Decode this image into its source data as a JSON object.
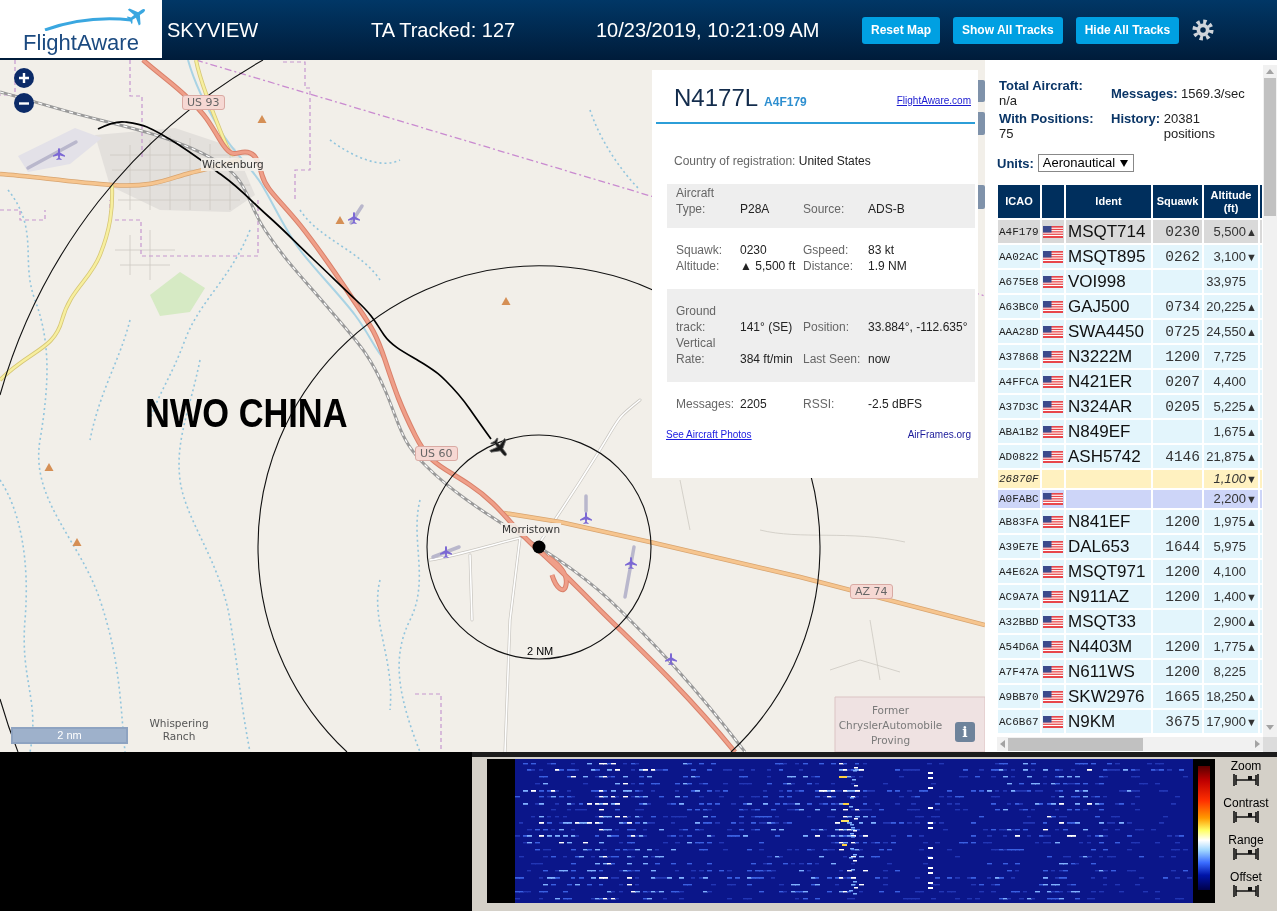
{
  "header": {
    "logo": "FlightAware",
    "title": "SKYVIEW",
    "tracked": "TA Tracked: 127",
    "datetime": "10/23/2019, 10:21:09 AM",
    "buttons": [
      "Reset Map",
      "Show All Tracks",
      "Hide All Tracks"
    ]
  },
  "map": {
    "labels": [
      {
        "kind": "shield",
        "text": "US 93"
      },
      {
        "kind": "town",
        "text": "Wickenburg"
      },
      {
        "kind": "shield",
        "text": "US 60"
      },
      {
        "kind": "town",
        "text": "Morristown"
      },
      {
        "kind": "shield",
        "text": "AZ 74"
      },
      {
        "kind": "ring",
        "text": "2 NM"
      },
      {
        "kind": "place",
        "text": "Whispering Ranch"
      },
      {
        "kind": "area",
        "text": "Former ChryslerAutomobile Proving"
      }
    ],
    "caption": "NWO CHINA",
    "scale": "2 nm",
    "info_button": "i"
  },
  "selected_aircraft": {
    "registration": "N4177L",
    "icao": "A4F179",
    "link": "FlightAware.com",
    "country_label": "Country of registration:",
    "country": "United States",
    "sections": [
      {
        "shaded": true,
        "rows": [
          [
            {
              "label": "Aircraft Type:",
              "value": "P28A"
            },
            {
              "label": "Source:",
              "value": "ADS-B"
            }
          ]
        ]
      },
      {
        "shaded": false,
        "rows": [
          [
            {
              "label": "Squawk:",
              "value": "0230"
            },
            {
              "label": "Gspeed:",
              "value": "83 kt"
            }
          ],
          [
            {
              "label": "Altitude:",
              "value": "▲ 5,500 ft"
            },
            {
              "label": "Distance:",
              "value": "1.9 NM"
            }
          ]
        ]
      },
      {
        "shaded": true,
        "rows": [
          [
            {
              "label": "Ground track:",
              "value": "141° (SE)"
            },
            {
              "label": "Position:",
              "value": "33.884°, -112.635°"
            }
          ],
          [
            {
              "label": "Vertical Rate:",
              "value": "384 ft/min"
            },
            {
              "label": "Last Seen:",
              "value": "now"
            }
          ]
        ]
      },
      {
        "shaded": false,
        "rows": [
          [
            {
              "label": "Messages:",
              "value": "2205"
            },
            {
              "label": "RSSI:",
              "value": "-2.5 dBFS"
            }
          ]
        ]
      }
    ],
    "links": [
      "See Aircraft Photos",
      "AirFrames.org"
    ]
  },
  "stats": [
    {
      "label": "Total Aircraft:",
      "value": "n/a"
    },
    {
      "label": "Messages:",
      "value": "1569.3/sec"
    },
    {
      "label": "With Positions:",
      "value": "75"
    },
    {
      "label": "History:",
      "value": "20381 positions"
    }
  ],
  "units": {
    "label": "Units:",
    "value": "Aeronautical"
  },
  "table": {
    "columns": [
      "ICAO",
      "Ident",
      "Squawk",
      "Altitude (ft)"
    ],
    "rows": [
      {
        "icao": "A4F179",
        "flag": true,
        "ident": "MSQT714",
        "squawk": "0230",
        "altitude": "5,500",
        "trend": "▲",
        "kind": "default",
        "selected": true
      },
      {
        "icao": "AA02AC",
        "flag": true,
        "ident": "MSQT895",
        "squawk": "0262",
        "altitude": "3,100",
        "trend": "▼",
        "kind": "default",
        "selected": false
      },
      {
        "icao": "A675E8",
        "flag": true,
        "ident": "VOI998",
        "altitude": "33,975",
        "kind": "default",
        "selected": false
      },
      {
        "icao": "A63BC0",
        "flag": true,
        "ident": "GAJ500",
        "squawk": "0734",
        "altitude": "20,225",
        "trend": "▲",
        "kind": "default",
        "selected": false
      },
      {
        "icao": "AAA28D",
        "flag": true,
        "ident": "SWA4450",
        "squawk": "0725",
        "altitude": "24,550",
        "trend": "▲",
        "kind": "default",
        "selected": false
      },
      {
        "icao": "A37868",
        "flag": true,
        "ident": "N3222M",
        "squawk": "1200",
        "altitude": "7,725",
        "kind": "default",
        "selected": false
      },
      {
        "icao": "A4FFCA",
        "flag": true,
        "ident": "N421ER",
        "squawk": "0207",
        "altitude": "4,400",
        "kind": "default",
        "selected": false
      },
      {
        "icao": "A37D3C",
        "flag": true,
        "ident": "N324AR",
        "squawk": "0205",
        "altitude": "5,225",
        "trend": "▲",
        "kind": "default",
        "selected": false
      },
      {
        "icao": "ABA1B2",
        "flag": true,
        "ident": "N849EF",
        "altitude": "1,675",
        "trend": "▲",
        "kind": "default",
        "selected": false
      },
      {
        "icao": "AD0822",
        "flag": true,
        "ident": "ASH5742",
        "squawk": "4146",
        "altitude": "21,875",
        "trend": "▲",
        "kind": "default",
        "selected": false
      },
      {
        "icao": "26870F",
        "flag": false,
        "altitude": "1,100",
        "trend": "▼",
        "kind": "yellow",
        "selected": false
      },
      {
        "icao": "A0FABC",
        "flag": true,
        "altitude": "2,200",
        "trend": "▼",
        "kind": "lavender",
        "selected": false
      },
      {
        "icao": "AB83FA",
        "flag": true,
        "ident": "N841EF",
        "squawk": "1200",
        "altitude": "1,975",
        "trend": "▲",
        "kind": "default",
        "selected": false
      },
      {
        "icao": "A39E7E",
        "flag": true,
        "ident": "DAL653",
        "squawk": "1644",
        "altitude": "5,975",
        "kind": "default",
        "selected": false
      },
      {
        "icao": "A4E62A",
        "flag": true,
        "ident": "MSQT971",
        "squawk": "1200",
        "altitude": "4,100",
        "kind": "default",
        "selected": false
      },
      {
        "icao": "AC9A7A",
        "flag": true,
        "ident": "N911AZ",
        "squawk": "1200",
        "altitude": "1,400",
        "trend": "▼",
        "kind": "default",
        "selected": false
      },
      {
        "icao": "A32BBD",
        "flag": true,
        "ident": "MSQT33",
        "altitude": "2,900",
        "trend": "▲",
        "kind": "default",
        "selected": false
      },
      {
        "icao": "A54D6A",
        "flag": true,
        "ident": "N4403M",
        "squawk": "1200",
        "altitude": "1,775",
        "trend": "▲",
        "kind": "default",
        "selected": false
      },
      {
        "icao": "A7F47A",
        "flag": true,
        "ident": "N611WS",
        "squawk": "1200",
        "altitude": "8,225",
        "kind": "default",
        "selected": false
      },
      {
        "icao": "A9BB70",
        "flag": true,
        "ident": "SKW2976",
        "squawk": "1665",
        "altitude": "18,250",
        "trend": "▲",
        "kind": "default",
        "selected": false
      },
      {
        "icao": "AC6B67",
        "flag": true,
        "ident": "N9KM",
        "squawk": "3675",
        "altitude": "17,900",
        "trend": "▼",
        "kind": "default",
        "selected": false
      }
    ]
  },
  "waterfall": {
    "controls": [
      "Zoom",
      "Contrast",
      "Range",
      "Offset"
    ]
  }
}
